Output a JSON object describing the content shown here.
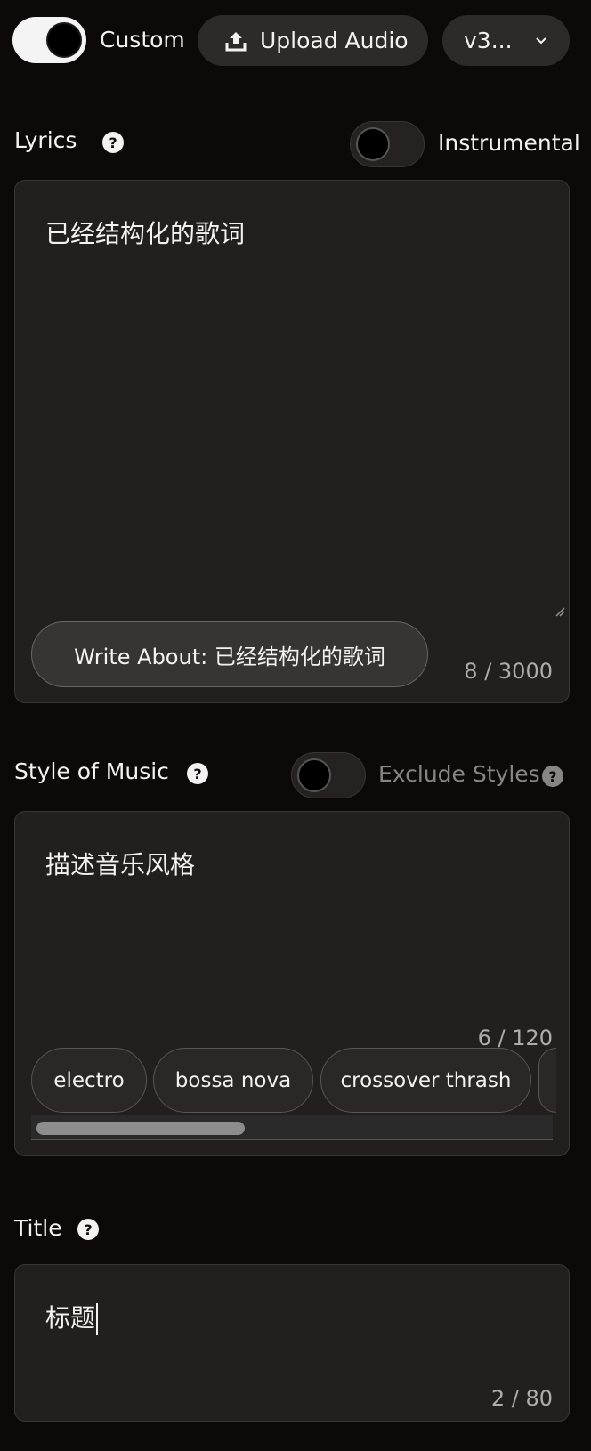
{
  "top_bar": {
    "custom_label": "Custom",
    "upload_label": "Upload Audio",
    "version_label": "v3..."
  },
  "lyrics": {
    "label": "Lyrics",
    "instrumental_label": "Instrumental",
    "text": "已经结构化的歌词",
    "write_about_label": "Write About: 已经结构化的歌词",
    "counter": "8 / 3000"
  },
  "style": {
    "label": "Style of Music",
    "exclude_label": "Exclude Styles",
    "text": "描述音乐风格",
    "counter": "6 / 120",
    "tags": [
      "electro",
      "bossa nova",
      "crossover thrash"
    ]
  },
  "title": {
    "label": "Title",
    "text": "标题",
    "counter": "2 / 80"
  },
  "icons": {
    "upload": "upload-icon",
    "chevron": "chevron-down-icon",
    "help": "question-icon"
  },
  "colors": {
    "background": "#0e0909",
    "panel": "#231f1f",
    "muted_text": "#b0acac"
  }
}
